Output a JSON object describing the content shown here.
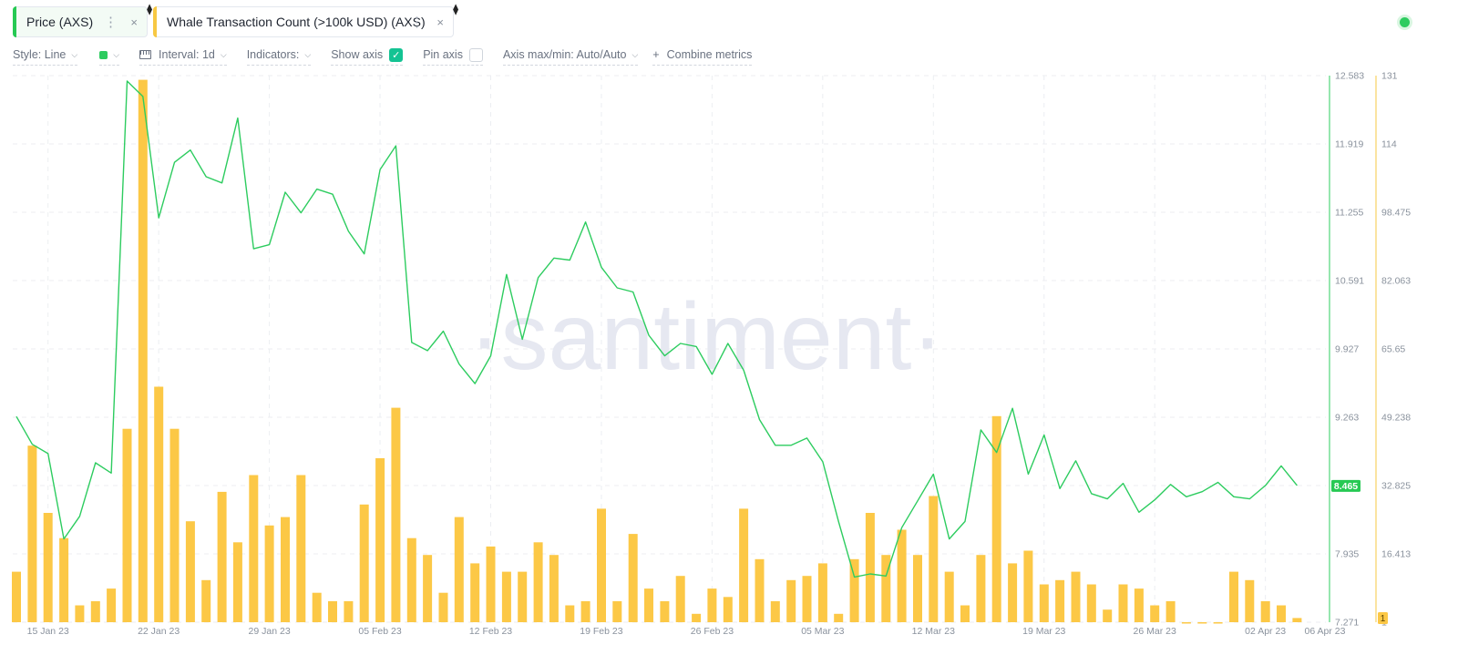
{
  "tabs": [
    {
      "label": "Price (AXS)",
      "color": "#26c953",
      "kebab": "⋮",
      "close": "×"
    },
    {
      "label": "Whale Transaction Count (>100k USD) (AXS)",
      "color": "#f7c843",
      "kebab": "⋮",
      "close": "×"
    }
  ],
  "toolbar": {
    "style": "Style: Line",
    "interval": "Interval: 1d",
    "indicators": "Indicators:",
    "show_axis": "Show axis",
    "show_axis_checked": true,
    "pin_axis": "Pin axis",
    "pin_axis_checked": false,
    "axis_maxmin": "Axis max/min: Auto/Auto",
    "combine": "Combine metrics",
    "line_color": "#2dcc5f"
  },
  "watermark": "·santiment·",
  "chart_data": {
    "type": "line+bar",
    "x_tick_labels": [
      "15 Jan 23",
      "22 Jan 23",
      "29 Jan 23",
      "05 Feb 23",
      "12 Feb 23",
      "19 Feb 23",
      "26 Feb 23",
      "05 Mar 23",
      "12 Mar 23",
      "19 Mar 23",
      "26 Mar 23",
      "02 Apr 23",
      "06 Apr 23"
    ],
    "x_start_date": "2023-01-13",
    "grid": true,
    "y_left_ticks": [
      "12.583",
      "11.919",
      "11.255",
      "10.591",
      "9.927",
      "9.263",
      "8.599",
      "7.935",
      "7.271"
    ],
    "y_left_range": [
      7.271,
      12.583
    ],
    "y_right_ticks": [
      "131",
      "114",
      "98.475",
      "82.063",
      "65.65",
      "49.238",
      "32.825",
      "16.413",
      "1"
    ],
    "y_right_range": [
      1,
      131
    ],
    "current_price_label": "8.465",
    "current_whale_label": "1",
    "series": [
      {
        "name": "Price (AXS)",
        "type": "line",
        "color": "#2dcc5f",
        "axis": "left",
        "values": [
          9.27,
          9.0,
          8.91,
          8.08,
          8.3,
          8.82,
          8.72,
          12.53,
          12.38,
          11.2,
          11.74,
          11.86,
          11.6,
          11.54,
          12.17,
          10.9,
          10.94,
          11.45,
          11.25,
          11.48,
          11.43,
          11.07,
          10.85,
          11.67,
          11.9,
          9.99,
          9.91,
          10.1,
          9.78,
          9.59,
          9.86,
          10.65,
          10.02,
          10.62,
          10.81,
          10.79,
          11.16,
          10.72,
          10.52,
          10.48,
          10.06,
          9.86,
          9.98,
          9.95,
          9.68,
          9.98,
          9.72,
          9.24,
          8.99,
          8.99,
          9.06,
          8.83,
          8.25,
          7.71,
          7.74,
          7.72,
          8.19,
          8.45,
          8.71,
          8.08,
          8.25,
          9.14,
          8.92,
          9.35,
          8.71,
          9.09,
          8.57,
          8.84,
          8.52,
          8.47,
          8.62,
          8.34,
          8.46,
          8.61,
          8.49,
          8.54,
          8.63,
          8.49,
          8.47,
          8.6,
          8.79,
          8.6
        ]
      },
      {
        "name": "Whale Transaction Count (>100k USD) (AXS)",
        "type": "bar",
        "color": "#fcc846",
        "axis": "right",
        "values": [
          13,
          43,
          27,
          21,
          5,
          6,
          9,
          47,
          130,
          57,
          47,
          25,
          11,
          32,
          20,
          36,
          24,
          26,
          36,
          8,
          6,
          6,
          29,
          40,
          52,
          21,
          17,
          8,
          26,
          15,
          19,
          13,
          13,
          20,
          17,
          5,
          6,
          28,
          6,
          22,
          9,
          6,
          12,
          3,
          9,
          7,
          28,
          16,
          6,
          11,
          12,
          15,
          3,
          16,
          27,
          17,
          23,
          17,
          31,
          13,
          5,
          17,
          50,
          15,
          18,
          10,
          11,
          13,
          10,
          4,
          10,
          9,
          5,
          6,
          1,
          1,
          1,
          13,
          11,
          6,
          5,
          2
        ]
      }
    ]
  }
}
